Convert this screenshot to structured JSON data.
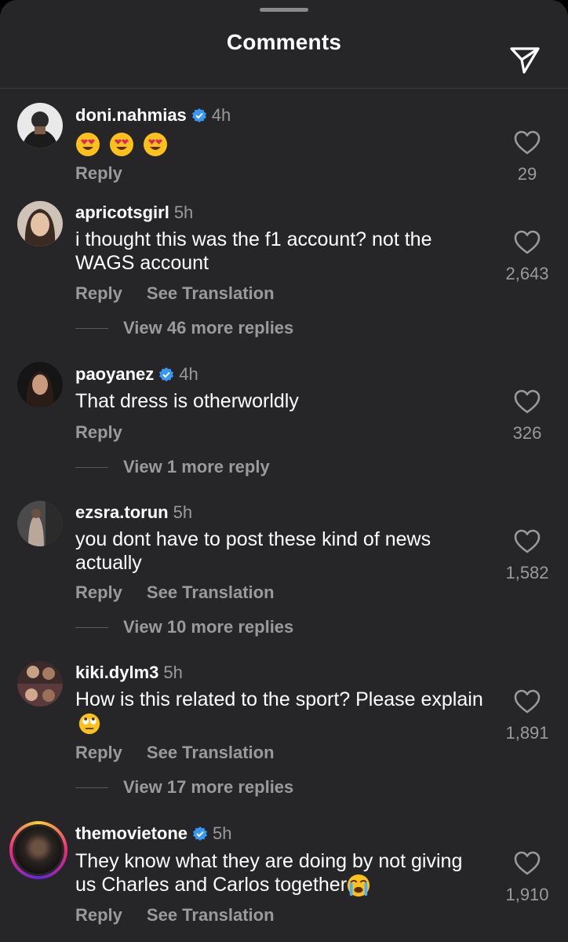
{
  "header": {
    "title": "Comments",
    "share_icon": "send-icon"
  },
  "comments": [
    {
      "username": "doni.nahmias",
      "verified": true,
      "time": "4h",
      "text": "",
      "emoji": "heart-eyes x3",
      "likes": "29",
      "reply": "Reply"
    },
    {
      "username": "apricotsgirl",
      "verified": false,
      "time": "5h",
      "text": "i thought this was the f1 account? not the WAGS account",
      "likes": "2,643",
      "reply": "Reply",
      "translate": "See Translation",
      "view_replies": "View 46 more replies"
    },
    {
      "username": "paoyanez",
      "verified": true,
      "time": "4h",
      "text": "That dress is otherworldly",
      "likes": "326",
      "reply": "Reply",
      "view_replies": "View 1 more reply"
    },
    {
      "username": "ezsra.torun",
      "verified": false,
      "time": "5h",
      "text": "you dont have to post these kind of news actually",
      "likes": "1,582",
      "reply": "Reply",
      "translate": "See Translation",
      "view_replies": "View 10 more replies"
    },
    {
      "username": "kiki.dylm3",
      "verified": false,
      "time": "5h",
      "text": "How is this related to the sport? Please explain",
      "emoji": "eye-roll",
      "likes": "1,891",
      "reply": "Reply",
      "translate": "See Translation",
      "view_replies": "View 17 more replies"
    },
    {
      "username": "themovietone",
      "verified": true,
      "time": "5h",
      "text": "They know what they are doing by not giving us Charles and Carlos together",
      "emoji": "crying",
      "likes": "1,910",
      "reply": "Reply",
      "translate": "See Translation"
    }
  ],
  "colors": {
    "background": "#262628",
    "secondary_text": "#9a9a9e",
    "verified": "#3897f0"
  }
}
